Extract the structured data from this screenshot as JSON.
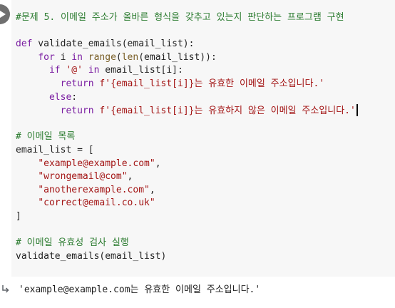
{
  "cell": {
    "run_button_icon": "play-icon",
    "code_lines": [
      [
        {
          "t": "#문제 5. 이메일 주소가 올바른 형식을 갖추고 있는지 판단하는 프로그램 구현",
          "c": "comment"
        }
      ],
      [],
      [
        {
          "t": "def",
          "c": "keyword"
        },
        {
          "t": " validate_emails(email_list):",
          "c": "default"
        }
      ],
      [
        {
          "t": "    ",
          "c": "default"
        },
        {
          "t": "for",
          "c": "keyword"
        },
        {
          "t": " i ",
          "c": "default"
        },
        {
          "t": "in",
          "c": "keyword"
        },
        {
          "t": " ",
          "c": "default"
        },
        {
          "t": "range",
          "c": "builtin"
        },
        {
          "t": "(",
          "c": "default"
        },
        {
          "t": "len",
          "c": "builtin"
        },
        {
          "t": "(email_list)):",
          "c": "default"
        }
      ],
      [
        {
          "t": "      ",
          "c": "default"
        },
        {
          "t": "if",
          "c": "keyword"
        },
        {
          "t": " ",
          "c": "default"
        },
        {
          "t": "'@'",
          "c": "string"
        },
        {
          "t": " ",
          "c": "default"
        },
        {
          "t": "in",
          "c": "keyword"
        },
        {
          "t": " email_list[i]:",
          "c": "default"
        }
      ],
      [
        {
          "t": "        ",
          "c": "default"
        },
        {
          "t": "return",
          "c": "keyword"
        },
        {
          "t": " ",
          "c": "default"
        },
        {
          "t": "f'{email_list[i]}는 유효한 이메일 주소입니다.'",
          "c": "string"
        }
      ],
      [
        {
          "t": "      ",
          "c": "default"
        },
        {
          "t": "else",
          "c": "keyword"
        },
        {
          "t": ":",
          "c": "default"
        }
      ],
      [
        {
          "t": "        ",
          "c": "default"
        },
        {
          "t": "return",
          "c": "keyword"
        },
        {
          "t": " ",
          "c": "default"
        },
        {
          "t": "f'{email_list[i]}는 유효하지 않은 이메일 주소입니다.'",
          "c": "string"
        },
        {
          "t": "",
          "c": "cursor"
        }
      ],
      [],
      [
        {
          "t": "# 이메일 목록",
          "c": "comment"
        }
      ],
      [
        {
          "t": "email_list = [",
          "c": "default"
        }
      ],
      [
        {
          "t": "    ",
          "c": "default"
        },
        {
          "t": "\"example@example.com\"",
          "c": "string"
        },
        {
          "t": ",",
          "c": "default"
        }
      ],
      [
        {
          "t": "    ",
          "c": "default"
        },
        {
          "t": "\"wrongemail@com\"",
          "c": "string"
        },
        {
          "t": ",",
          "c": "default"
        }
      ],
      [
        {
          "t": "    ",
          "c": "default"
        },
        {
          "t": "\"anotherexample.com\"",
          "c": "string"
        },
        {
          "t": ",",
          "c": "default"
        }
      ],
      [
        {
          "t": "    ",
          "c": "default"
        },
        {
          "t": "\"correct@email.co.uk\"",
          "c": "string"
        }
      ],
      [
        {
          "t": "]",
          "c": "default"
        }
      ],
      [],
      [
        {
          "t": "# 이메일 유효성 검사 실행",
          "c": "comment"
        }
      ],
      [
        {
          "t": "validate_emails(email_list)",
          "c": "default"
        }
      ]
    ]
  },
  "output": {
    "icon": "output-arrow-icon",
    "text": "'example@example.com는 유효한 이메일 주소입니다.'"
  }
}
